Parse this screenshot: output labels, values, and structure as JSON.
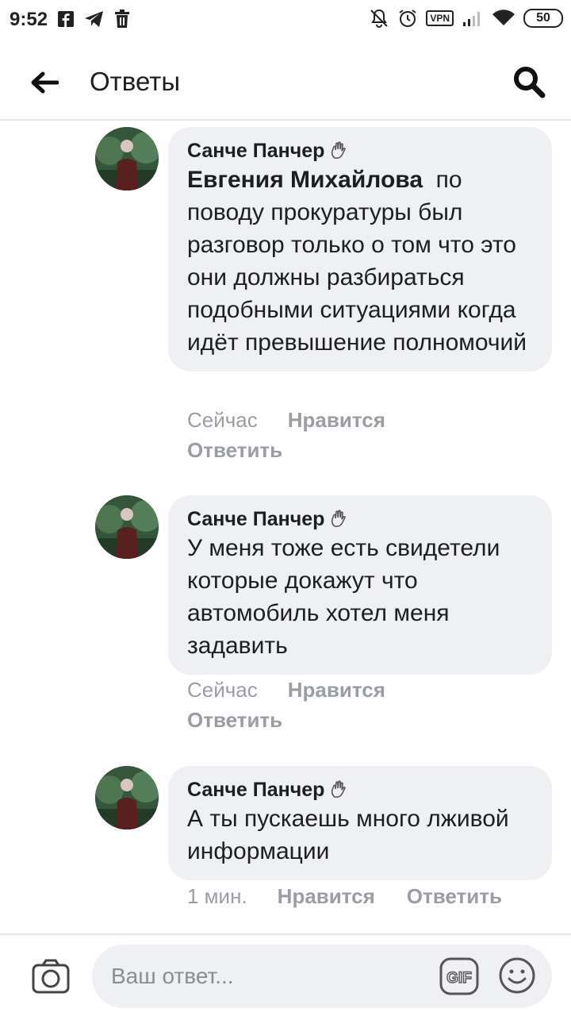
{
  "status_bar": {
    "time": "9:52",
    "battery": "50",
    "vpn_label": "VPN",
    "left_icons": [
      "facebook-icon",
      "telegram-icon",
      "trash-icon"
    ],
    "right_icons": [
      "mute-icon",
      "alarm-icon",
      "vpn-icon",
      "signal-icon",
      "wifi-icon",
      "battery-icon"
    ]
  },
  "header": {
    "title": "Ответы"
  },
  "comments": [
    {
      "author": "Санче Панчер",
      "mention": "Евгения Михайлова",
      "text": "по поводу прокуратуры был разговор только о том что это они должны разбираться подобными ситуациями когда идёт превышение полномочий",
      "time": "Сейчас",
      "like_label": "Нравится",
      "reply_label": "Ответить"
    },
    {
      "author": "Санче Панчер",
      "text": "У меня тоже есть свидетели которые докажут что автомобиль хотел меня задавить",
      "time": "Сейчас",
      "like_label": "Нравится",
      "reply_label": "Ответить"
    },
    {
      "author": "Санче Панчер",
      "text": "А ты пускаешь много лживой информации",
      "time": "1 мин.",
      "like_label": "Нравится",
      "reply_label": "Ответить"
    }
  ],
  "composer": {
    "placeholder": "Ваш ответ...",
    "gif_label": "GIF"
  },
  "colors": {
    "bubble": "#eff0f4",
    "meta_text": "#9a9da3",
    "primary_text": "#1c1e21"
  }
}
